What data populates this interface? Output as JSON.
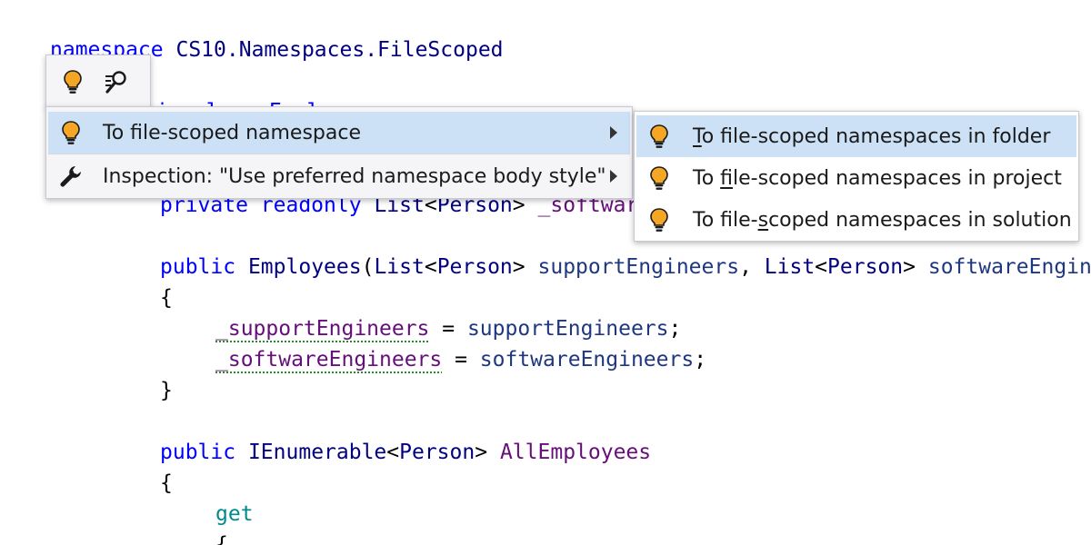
{
  "code": {
    "line1": {
      "kw": "namespace",
      "name": "CS10.Namespaces.FileScoped"
    },
    "line2": {
      "text": "public class Employees"
    },
    "line3": {
      "kw1": "private",
      "kw2": "readonly",
      "type1": "List",
      "lt": "<",
      "type2": "Person",
      "gt": ">",
      "field": "_softwareEngineers;"
    },
    "line4": {
      "kw": "public",
      "name": "Employees",
      "paren": "(",
      "type1": "List",
      "lt": "<",
      "type2": "Person",
      "gt": ">",
      "param1": "supportEngineers",
      "comma": ",",
      "type3": "List",
      "lt2": "<",
      "type4": "Person",
      "gt2": ">",
      "param2": "softwareEngineers"
    },
    "line5": {
      "text": "{"
    },
    "line6": {
      "field": "_supportEngineers",
      "op": " = ",
      "param": "supportEngineers",
      "semi": ";"
    },
    "line7": {
      "field": "_softwareEngineers",
      "op": " = ",
      "param": "softwareEngineers",
      "semi": ";"
    },
    "line8": {
      "text": "}"
    },
    "line9": {
      "kw": "public",
      "type1": "IEnumerable",
      "lt": "<",
      "type2": "Person",
      "gt": ">",
      "name": "AllEmployees"
    },
    "line10": {
      "text": "{"
    },
    "line11": {
      "kw": "get"
    },
    "line12": {
      "text": "{"
    }
  },
  "toolbar": {
    "icons": [
      "lightbulb-icon",
      "inspect-icon"
    ]
  },
  "menu": {
    "items": [
      {
        "label": "To file-scoped namespace",
        "icon": "lightbulb-icon",
        "selected": true
      },
      {
        "label": "Inspection: \"Use preferred namespace body style\"",
        "icon": "wrench-icon",
        "selected": false
      }
    ]
  },
  "submenu": {
    "items": [
      {
        "pre": "",
        "ul": "T",
        "post": "o file-scoped namespaces in folder",
        "icon": "lightbulb-icon",
        "selected": true
      },
      {
        "pre": "To ",
        "ul": "f",
        "post": "ile-scoped namespaces in project",
        "icon": "lightbulb-icon",
        "selected": false
      },
      {
        "pre": "To file-",
        "ul": "s",
        "post": "coped namespaces in solution",
        "icon": "lightbulb-icon",
        "selected": false
      }
    ]
  },
  "colors": {
    "keyword": "#0000ff",
    "field": "#660e7a",
    "parameter": "#1f377f",
    "accessor": "#008b8b",
    "selection": "#cce1f5",
    "bulb": "#f5a623"
  }
}
